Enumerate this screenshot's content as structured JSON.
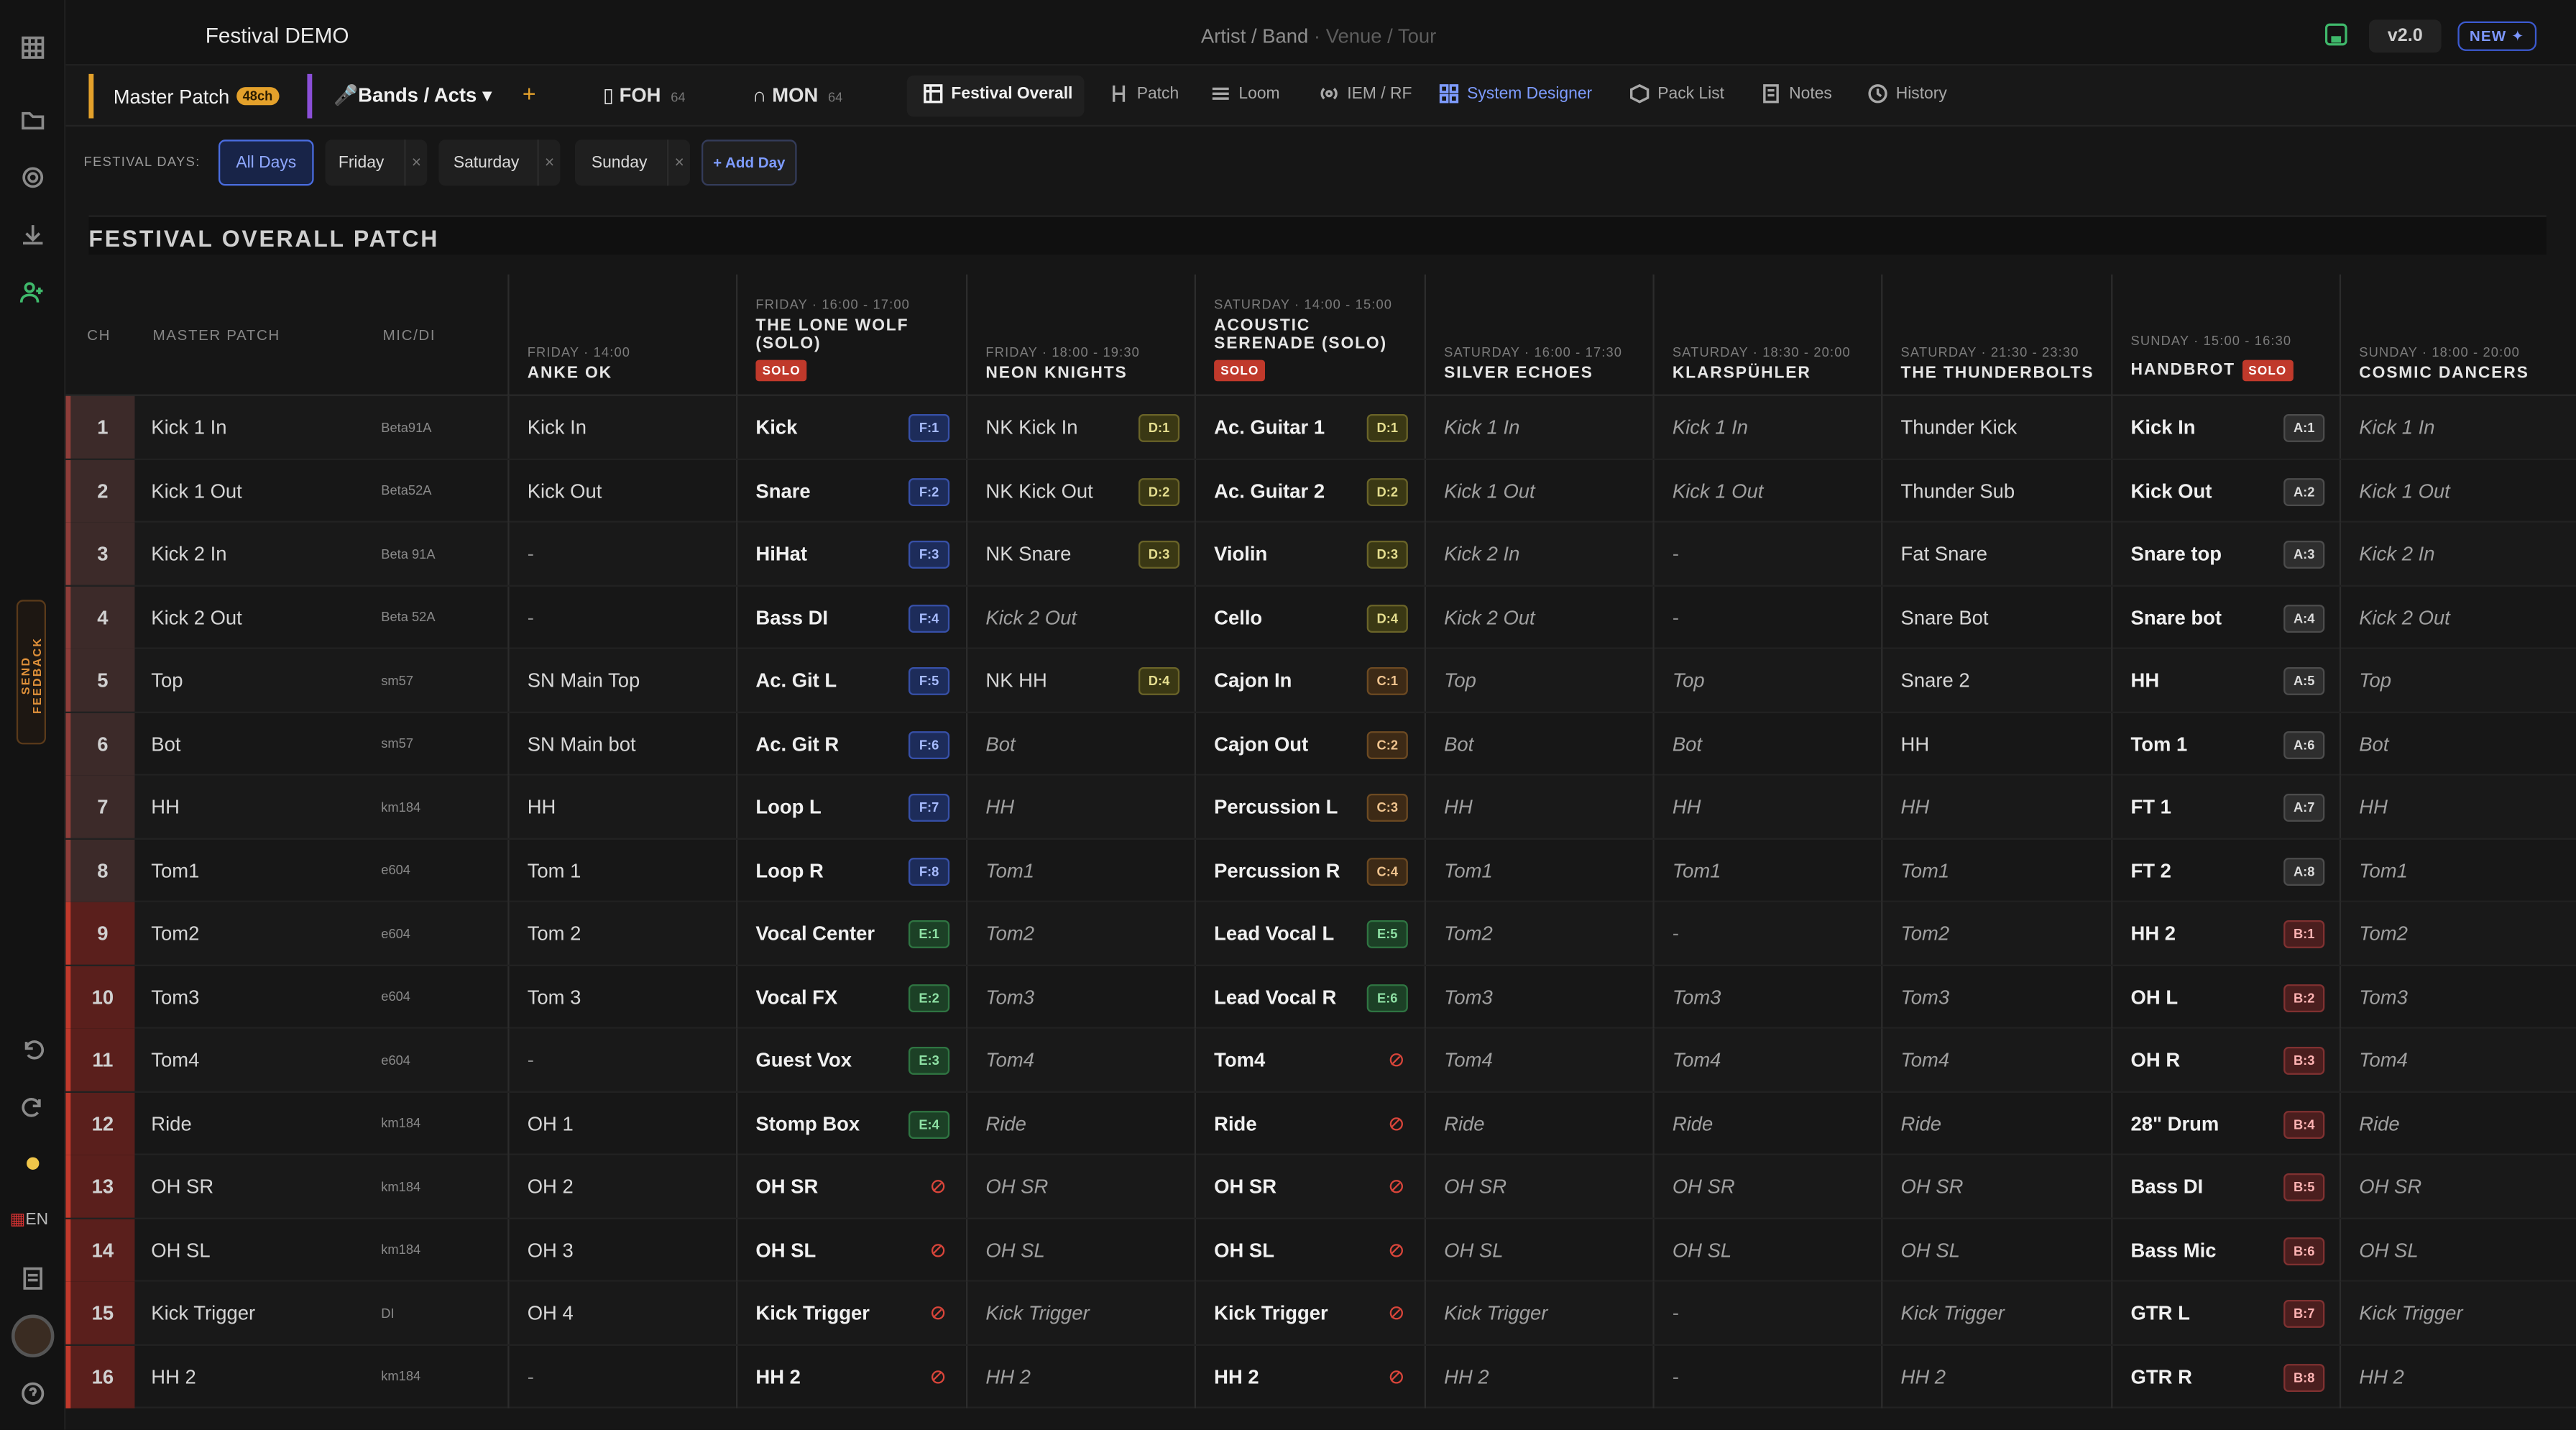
{
  "app": {
    "title": "Festival DEMO",
    "breadcrumb": {
      "artist": "Artist / Band",
      "venue": "Venue",
      "tour": "Tour"
    },
    "version": "v2.0",
    "new_badge": "NEW ✦"
  },
  "rail": {
    "feedback": "SEND FEEDBACK",
    "lang": "EN"
  },
  "tabs": {
    "master_patch": "Master Patch",
    "master_badge": "48ch",
    "bands": "Bands / Acts ▾",
    "add": "+",
    "foh": "FOH",
    "foh_n": "64",
    "mon": "MON",
    "mon_n": "64",
    "views": [
      "Festival Overall",
      "Patch",
      "Loom",
      "IEM / RF",
      "System Designer",
      "Pack List",
      "Notes",
      "History"
    ]
  },
  "days": {
    "label": "FESTIVAL DAYS:",
    "all": "All Days",
    "list": [
      "Friday",
      "Saturday",
      "Sunday"
    ],
    "add": "+ Add Day"
  },
  "section_title": "FESTIVAL OVERALL PATCH",
  "columns": {
    "ch": "CH",
    "master": "MASTER PATCH",
    "mic": "MIC/DI"
  },
  "bands": [
    {
      "meta": "FRIDAY · 14:00",
      "name": "ANKE OK",
      "solo": ""
    },
    {
      "meta": "FRIDAY · 16:00 - 17:00",
      "name": "THE LONE WOLF (SOLO)",
      "solo": "SOLO"
    },
    {
      "meta": "FRIDAY · 18:00 - 19:30",
      "name": "NEON KNIGHTS",
      "solo": ""
    },
    {
      "meta": "SATURDAY · 14:00 - 15:00",
      "name": "ACOUSTIC SERENADE (SOLO)",
      "solo": "SOLO"
    },
    {
      "meta": "SATURDAY · 16:00 - 17:30",
      "name": "SILVER ECHOES",
      "solo": ""
    },
    {
      "meta": "SATURDAY · 18:30 - 20:00",
      "name": "KLARSPÜHLER",
      "solo": ""
    },
    {
      "meta": "SATURDAY · 21:30 - 23:30",
      "name": "THE THUNDERBOLTS",
      "solo": ""
    },
    {
      "meta": "SUNDAY · 15:00 - 16:30",
      "name": "HANDBROT",
      "solo": "SOLO"
    },
    {
      "meta": "SUNDAY · 18:00 - 20:00",
      "name": "COSMIC DANCERS",
      "solo": ""
    }
  ],
  "rows": [
    {
      "ch": "1",
      "master": "Kick 1 In",
      "mic": "Beta91A",
      "cells": [
        [
          "Kick In",
          "n"
        ],
        [
          "Kick",
          "b",
          "F:1"
        ],
        [
          "NK Kick In",
          "n",
          "D:1"
        ],
        [
          "Ac. Guitar 1",
          "b",
          "D:1"
        ],
        [
          "Kick 1 In",
          "i"
        ],
        [
          "Kick 1 In",
          "i"
        ],
        [
          "Thunder Kick",
          "n"
        ],
        [
          "Kick In",
          "b",
          "A:1"
        ],
        [
          "Kick 1 In",
          "i"
        ]
      ]
    },
    {
      "ch": "2",
      "master": "Kick 1 Out",
      "mic": "Beta52A",
      "cells": [
        [
          "Kick Out",
          "n"
        ],
        [
          "Snare",
          "b",
          "F:2"
        ],
        [
          "NK Kick Out",
          "n",
          "D:2"
        ],
        [
          "Ac. Guitar 2",
          "b",
          "D:2"
        ],
        [
          "Kick 1 Out",
          "i"
        ],
        [
          "Kick 1 Out",
          "i"
        ],
        [
          "Thunder Sub",
          "n"
        ],
        [
          "Kick Out",
          "b",
          "A:2"
        ],
        [
          "Kick 1 Out",
          "i"
        ]
      ]
    },
    {
      "ch": "3",
      "master": "Kick 2 In",
      "mic": "Beta 91A",
      "cells": [
        [
          "-",
          "d"
        ],
        [
          "HiHat",
          "b",
          "F:3"
        ],
        [
          "NK Snare",
          "n",
          "D:3"
        ],
        [
          "Violin",
          "b",
          "D:3"
        ],
        [
          "Kick 2 In",
          "i"
        ],
        [
          "-",
          "d"
        ],
        [
          "Fat Snare",
          "n"
        ],
        [
          "Snare top",
          "b",
          "A:3"
        ],
        [
          "Kick 2 In",
          "i"
        ]
      ]
    },
    {
      "ch": "4",
      "master": "Kick 2 Out",
      "mic": "Beta 52A",
      "cells": [
        [
          "-",
          "d"
        ],
        [
          "Bass DI",
          "b",
          "F:4"
        ],
        [
          "Kick 2 Out",
          "i"
        ],
        [
          "Cello",
          "b",
          "D:4"
        ],
        [
          "Kick 2 Out",
          "i"
        ],
        [
          "-",
          "d"
        ],
        [
          "Snare Bot",
          "n"
        ],
        [
          "Snare bot",
          "b",
          "A:4"
        ],
        [
          "Kick 2 Out",
          "i"
        ]
      ]
    },
    {
      "ch": "5",
      "master": "Top",
      "mic": "sm57",
      "cells": [
        [
          "SN Main Top",
          "n"
        ],
        [
          "Ac. Git L",
          "b",
          "F:5"
        ],
        [
          "NK HH",
          "n",
          "D:4"
        ],
        [
          "Cajon In",
          "b",
          "C:1"
        ],
        [
          "Top",
          "i"
        ],
        [
          "Top",
          "i"
        ],
        [
          "Snare 2",
          "n"
        ],
        [
          "HH",
          "b",
          "A:5"
        ],
        [
          "Top",
          "i"
        ]
      ]
    },
    {
      "ch": "6",
      "master": "Bot",
      "mic": "sm57",
      "cells": [
        [
          "SN Main bot",
          "n"
        ],
        [
          "Ac. Git R",
          "b",
          "F:6"
        ],
        [
          "Bot",
          "i"
        ],
        [
          "Cajon Out",
          "b",
          "C:2"
        ],
        [
          "Bot",
          "i"
        ],
        [
          "Bot",
          "i"
        ],
        [
          "HH",
          "n"
        ],
        [
          "Tom 1",
          "b",
          "A:6"
        ],
        [
          "Bot",
          "i"
        ]
      ]
    },
    {
      "ch": "7",
      "master": "HH",
      "mic": "km184",
      "cells": [
        [
          "HH",
          "n"
        ],
        [
          "Loop L",
          "b",
          "F:7"
        ],
        [
          "HH",
          "i"
        ],
        [
          "Percussion L",
          "b",
          "C:3"
        ],
        [
          "HH",
          "i"
        ],
        [
          "HH",
          "i"
        ],
        [
          "HH",
          "i"
        ],
        [
          "FT 1",
          "b",
          "A:7"
        ],
        [
          "HH",
          "i"
        ]
      ]
    },
    {
      "ch": "8",
      "master": "Tom1",
      "mic": "e604",
      "cells": [
        [
          "Tom 1",
          "n"
        ],
        [
          "Loop R",
          "b",
          "F:8"
        ],
        [
          "Tom1",
          "i"
        ],
        [
          "Percussion R",
          "b",
          "C:4"
        ],
        [
          "Tom1",
          "i"
        ],
        [
          "Tom1",
          "i"
        ],
        [
          "Tom1",
          "i"
        ],
        [
          "FT 2",
          "b",
          "A:8"
        ],
        [
          "Tom1",
          "i"
        ]
      ]
    },
    {
      "ch": "9",
      "master": "Tom2",
      "mic": "e604",
      "cells": [
        [
          "Tom 2",
          "n"
        ],
        [
          "Vocal Center",
          "b",
          "E:1"
        ],
        [
          "Tom2",
          "i"
        ],
        [
          "Lead Vocal L",
          "b",
          "E:5"
        ],
        [
          "Tom2",
          "i"
        ],
        [
          "-",
          "d"
        ],
        [
          "Tom2",
          "i"
        ],
        [
          "HH 2",
          "b",
          "B:1"
        ],
        [
          "Tom2",
          "i"
        ]
      ]
    },
    {
      "ch": "10",
      "master": "Tom3",
      "mic": "e604",
      "cells": [
        [
          "Tom 3",
          "n"
        ],
        [
          "Vocal FX",
          "b",
          "E:2"
        ],
        [
          "Tom3",
          "i"
        ],
        [
          "Lead Vocal R",
          "b",
          "E:6"
        ],
        [
          "Tom3",
          "i"
        ],
        [
          "Tom3",
          "i"
        ],
        [
          "Tom3",
          "i"
        ],
        [
          "OH L",
          "b",
          "B:2"
        ],
        [
          "Tom3",
          "i"
        ]
      ]
    },
    {
      "ch": "11",
      "master": "Tom4",
      "mic": "e604",
      "cells": [
        [
          "-",
          "d"
        ],
        [
          "Guest Vox",
          "b",
          "E:3"
        ],
        [
          "Tom4",
          "i"
        ],
        [
          "Tom4",
          "b",
          "x"
        ],
        [
          "Tom4",
          "i"
        ],
        [
          "Tom4",
          "i"
        ],
        [
          "Tom4",
          "i"
        ],
        [
          "OH R",
          "b",
          "B:3"
        ],
        [
          "Tom4",
          "i"
        ]
      ]
    },
    {
      "ch": "12",
      "master": "Ride",
      "mic": "km184",
      "cells": [
        [
          "OH 1",
          "n"
        ],
        [
          "Stomp Box",
          "b",
          "E:4"
        ],
        [
          "Ride",
          "i"
        ],
        [
          "Ride",
          "b",
          "x"
        ],
        [
          "Ride",
          "i"
        ],
        [
          "Ride",
          "i"
        ],
        [
          "Ride",
          "i"
        ],
        [
          "28\" Drum",
          "b",
          "B:4"
        ],
        [
          "Ride",
          "i"
        ]
      ]
    },
    {
      "ch": "13",
      "master": "OH SR",
      "mic": "km184",
      "cells": [
        [
          "OH 2",
          "n"
        ],
        [
          "OH SR",
          "b",
          "x"
        ],
        [
          "OH SR",
          "i"
        ],
        [
          "OH SR",
          "b",
          "x"
        ],
        [
          "OH SR",
          "i"
        ],
        [
          "OH SR",
          "i"
        ],
        [
          "OH SR",
          "i"
        ],
        [
          "Bass DI",
          "b",
          "B:5"
        ],
        [
          "OH SR",
          "i"
        ]
      ]
    },
    {
      "ch": "14",
      "master": "OH SL",
      "mic": "km184",
      "cells": [
        [
          "OH 3",
          "n"
        ],
        [
          "OH SL",
          "b",
          "x"
        ],
        [
          "OH SL",
          "i"
        ],
        [
          "OH SL",
          "b",
          "x"
        ],
        [
          "OH SL",
          "i"
        ],
        [
          "OH SL",
          "i"
        ],
        [
          "OH SL",
          "i"
        ],
        [
          "Bass Mic",
          "b",
          "B:6"
        ],
        [
          "OH SL",
          "i"
        ]
      ]
    },
    {
      "ch": "15",
      "master": "Kick Trigger",
      "mic": "DI",
      "cells": [
        [
          "OH 4",
          "n"
        ],
        [
          "Kick Trigger",
          "b",
          "x"
        ],
        [
          "Kick Trigger",
          "i"
        ],
        [
          "Kick Trigger",
          "b",
          "x"
        ],
        [
          "Kick Trigger",
          "i"
        ],
        [
          "-",
          "d"
        ],
        [
          "Kick Trigger",
          "i"
        ],
        [
          "GTR L",
          "b",
          "B:7"
        ],
        [
          "Kick Trigger",
          "i"
        ]
      ]
    },
    {
      "ch": "16",
      "master": "HH 2",
      "mic": "km184",
      "cells": [
        [
          "-",
          "d"
        ],
        [
          "HH 2",
          "b",
          "x"
        ],
        [
          "HH 2",
          "i"
        ],
        [
          "HH 2",
          "b",
          "x"
        ],
        [
          "HH 2",
          "i"
        ],
        [
          "-",
          "d"
        ],
        [
          "HH 2",
          "i"
        ],
        [
          "GTR R",
          "b",
          "B:8"
        ],
        [
          "HH 2",
          "i"
        ]
      ]
    }
  ],
  "colors": {
    "accent": "#e4a12b",
    "bands_divider": "#8b4fd8",
    "chip_active": "#4a6de0",
    "solo": "#c0392b"
  }
}
